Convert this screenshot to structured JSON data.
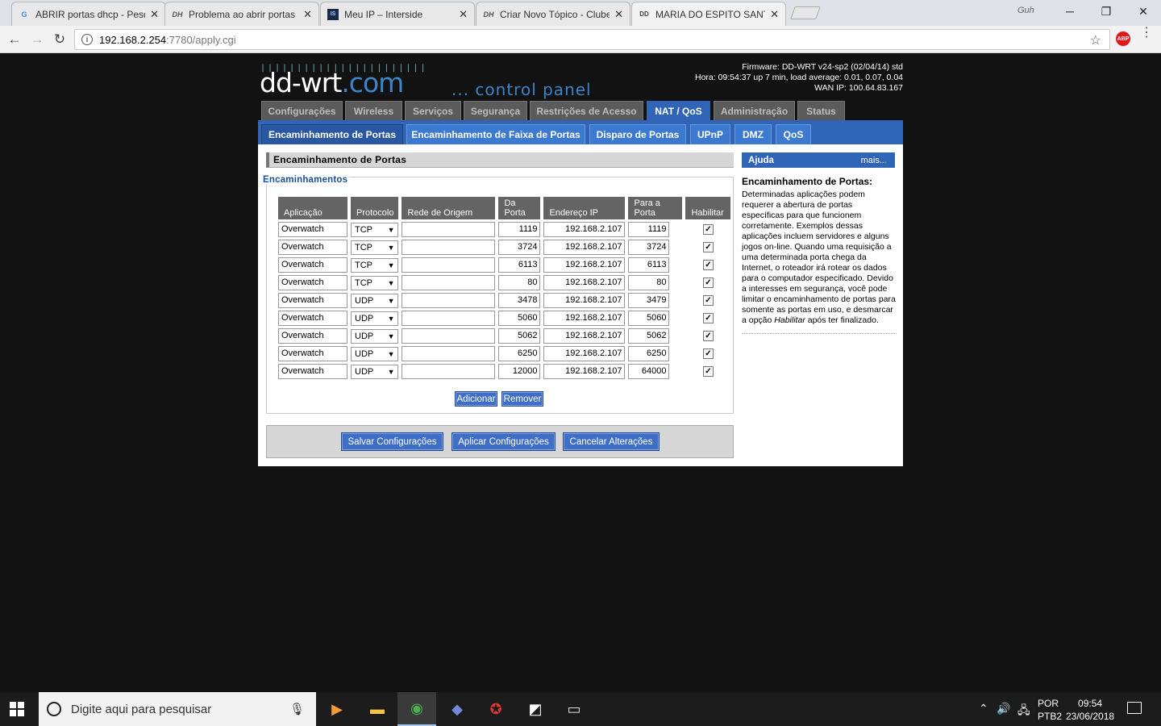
{
  "browser": {
    "tabs": [
      {
        "title": "ABRIR portas dhcp - Pesq",
        "favicon": "G"
      },
      {
        "title": "Problema ao abrir portas",
        "favicon": "DH"
      },
      {
        "title": "Meu IP – Interside",
        "favicon": "IS"
      },
      {
        "title": "Criar Novo Tópico - Clube",
        "favicon": "DH"
      },
      {
        "title": "MARIA DO ESPITO SANTO",
        "favicon": "DD"
      }
    ],
    "profile": "Guh",
    "url_host": "192.168.2.254",
    "url_path": ":7780/apply.cgi",
    "abp": "ABP"
  },
  "header": {
    "logo_bars": "|||||||||||||||||||||||",
    "logo_main": "dd-wrt",
    "logo_com": ".com",
    "control_panel": "... control panel",
    "firmware": "Firmware: DD-WRT v24-sp2 (02/04/14) std",
    "hora": "Hora: 09:54:37 up 7 min, load average: 0.01, 0.07, 0.04",
    "wan_ip": "WAN IP: 100.64.83.167"
  },
  "main_tabs": [
    "Configurações",
    "Wireless",
    "Serviços",
    "Segurança",
    "Restrições de Acesso",
    "NAT / QoS",
    "Administração",
    "Status"
  ],
  "sub_tabs": [
    "Encaminhamento de Portas",
    "Encaminhamento de Faixa de Portas",
    "Disparo de Portas",
    "UPnP",
    "DMZ",
    "QoS"
  ],
  "section_title": "Encaminhamento de Portas",
  "legend": "Encaminhamentos",
  "columns": [
    "Aplicação",
    "Protocolo",
    "Rede de Origem",
    "Da\nPorta",
    "Endereço IP",
    "Para a\nPorta",
    "Habilitar"
  ],
  "rows": [
    {
      "app": "Overwatch",
      "proto": "TCP",
      "src": "",
      "from": "1119",
      "ip": "192.168.2.107",
      "to": "1119",
      "enabled": true
    },
    {
      "app": "Overwatch",
      "proto": "TCP",
      "src": "",
      "from": "3724",
      "ip": "192.168.2.107",
      "to": "3724",
      "enabled": true
    },
    {
      "app": "Overwatch",
      "proto": "TCP",
      "src": "",
      "from": "6113",
      "ip": "192.168.2.107",
      "to": "6113",
      "enabled": true
    },
    {
      "app": "Overwatch",
      "proto": "TCP",
      "src": "",
      "from": "80",
      "ip": "192.168.2.107",
      "to": "80",
      "enabled": true
    },
    {
      "app": "Overwatch",
      "proto": "UDP",
      "src": "",
      "from": "3478",
      "ip": "192.168.2.107",
      "to": "3479",
      "enabled": true
    },
    {
      "app": "Overwatch",
      "proto": "UDP",
      "src": "",
      "from": "5060",
      "ip": "192.168.2.107",
      "to": "5060",
      "enabled": true
    },
    {
      "app": "Overwatch",
      "proto": "UDP",
      "src": "",
      "from": "5062",
      "ip": "192.168.2.107",
      "to": "5062",
      "enabled": true
    },
    {
      "app": "Overwatch",
      "proto": "UDP",
      "src": "",
      "from": "6250",
      "ip": "192.168.2.107",
      "to": "6250",
      "enabled": true
    },
    {
      "app": "Overwatch",
      "proto": "UDP",
      "src": "",
      "from": "12000",
      "ip": "192.168.2.107",
      "to": "64000",
      "enabled": true
    }
  ],
  "buttons": {
    "add": "Adicionar",
    "remove": "Remover",
    "save": "Salvar Configurações",
    "apply": "Aplicar Configurações",
    "cancel": "Cancelar Alterações"
  },
  "help": {
    "header": "Ajuda",
    "more": "mais...",
    "title": "Encaminhamento de Portas:",
    "text_before": "Determinadas aplicações podem requerer a abertura de portas específicas para que funcionem corretamente. Exemplos dessas aplicações incluem servidores e alguns jogos on-line. Quando uma requisição a uma determinada porta chega da Internet, o roteador irá rotear os dados para o computador especificado. Devido a interesses em segurança, você pode limitar o encaminhamento de portas para somente as portas em uso, e desmarcar a opção ",
    "text_em": "Habilitar",
    "text_after": " após ter finalizado."
  },
  "taskbar": {
    "search_placeholder": "Digite aqui para pesquisar",
    "lang1": "POR",
    "lang2": "PTB2",
    "time": "09:54",
    "date": "23/06/2018"
  },
  "colors": {
    "accent": "#3064b6",
    "button": "#3f6ec6",
    "header_col": "#646464"
  }
}
